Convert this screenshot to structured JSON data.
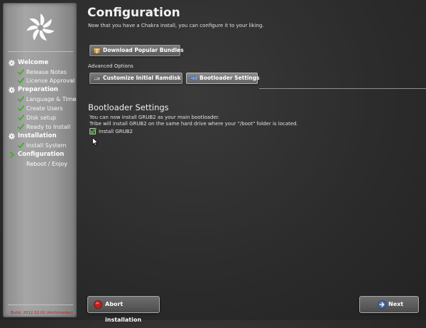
{
  "sidebar": {
    "items": [
      {
        "label": "Welcome",
        "type": "section"
      },
      {
        "label": "Release Notes",
        "type": "item"
      },
      {
        "label": "License Approval",
        "type": "item"
      },
      {
        "label": "Preparation",
        "type": "section"
      },
      {
        "label": "Language & Time",
        "type": "item"
      },
      {
        "label": "Create Users",
        "type": "item"
      },
      {
        "label": "Disk setup",
        "type": "item"
      },
      {
        "label": "Ready to Install",
        "type": "item"
      },
      {
        "label": "Installation",
        "type": "section"
      },
      {
        "label": "Install System",
        "type": "item"
      },
      {
        "label": "Configuration",
        "type": "current"
      },
      {
        "label": "Reboot / Enjoy",
        "type": "plain"
      }
    ],
    "build": "Build: 2012.02.02 (Archimedes)"
  },
  "main": {
    "title": "Configuration",
    "subtitle": "Now that you have a Chakra install, you can configure it to your liking.",
    "download_bundles_label": "Download Popular Bundles",
    "advanced_options_label": "Advanced Options",
    "customize_ramdisk_label": "Customize Initial Ramdisk",
    "bootloader_settings_label": "Bootloader Settings",
    "section_title": "Bootloader Settings",
    "description_1": "You can now install GRUB2 as your main bootloader.",
    "description_2": "Tribe will install GRUB2 on the same hard drive where your \"/boot\" folder is located.",
    "install_grub2_label": "Install GRUB2",
    "install_grub2_checked": true
  },
  "footer": {
    "abort_label": "Abort installation",
    "next_label": "Next"
  },
  "colors": {
    "check_green": "#3fae2a",
    "build_red": "#c11b1b",
    "abort_red": "#c0201e",
    "next_blue": "#4a6fb0"
  },
  "icons": {
    "logo": "chakra-logo-icon",
    "done": "green-check-icon",
    "section": "gear-icon",
    "current": "arrow-icon"
  }
}
